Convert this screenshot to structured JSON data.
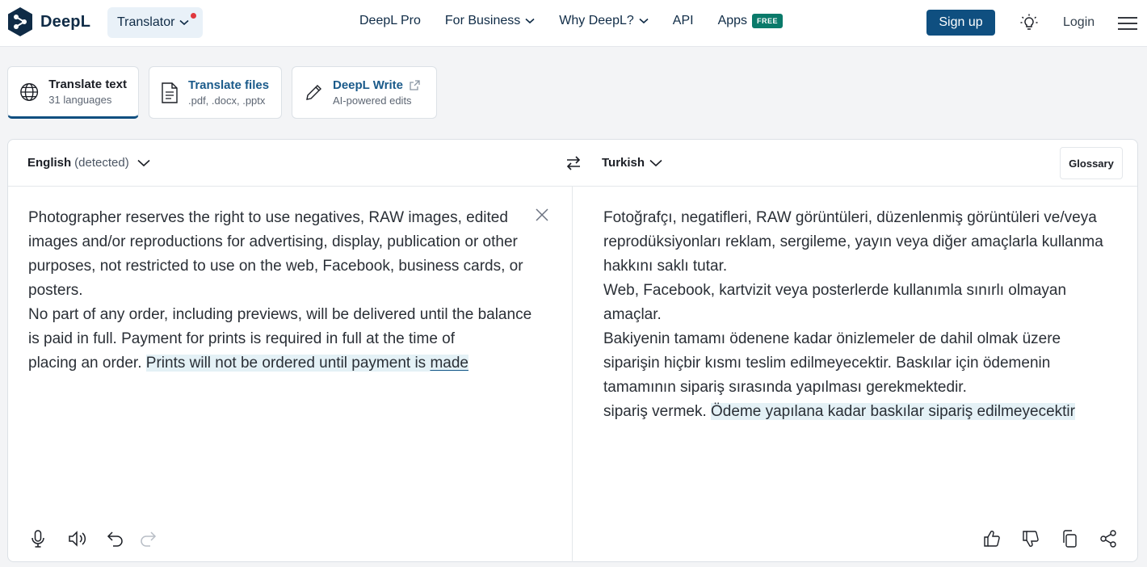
{
  "brand": {
    "name": "DeepL"
  },
  "header": {
    "translator_label": "Translator",
    "nav": [
      {
        "label": "DeepL Pro",
        "dropdown": false
      },
      {
        "label": "For Business",
        "dropdown": true
      },
      {
        "label": "Why DeepL?",
        "dropdown": true
      },
      {
        "label": "API",
        "dropdown": false
      },
      {
        "label": "Apps",
        "dropdown": false,
        "badge": "FREE"
      }
    ],
    "signup_label": "Sign up",
    "login_label": "Login"
  },
  "modes": [
    {
      "title": "Translate text",
      "subtitle": "31 languages",
      "icon": "globe-icon",
      "active": true
    },
    {
      "title": "Translate files",
      "subtitle": ".pdf, .docx, .pptx",
      "icon": "document-icon",
      "active": false
    },
    {
      "title": "DeepL Write",
      "subtitle": "AI-powered edits",
      "icon": "pen-icon",
      "active": false
    }
  ],
  "translator": {
    "source_lang": "English",
    "source_detected": "(detected)",
    "target_lang": "Turkish",
    "glossary_label": "Glossary",
    "source_lines": [
      "Photographer reserves the right to use negatives, RAW images, edited images and/or reproductions for advertising, display, publication or other",
      "purposes, not restricted to use on the web, Facebook, business cards, or posters.",
      "No part of any order, including previews, will be delivered until the balance is paid in full. Payment for prints is required in full at the time of",
      "placing an order."
    ],
    "source_highlight": "Prints will not be ordered until payment is",
    "source_underlined": "made",
    "target_lines": [
      "Fotoğrafçı, negatifleri, RAW görüntüleri, düzenlenmiş görüntüleri ve/veya reprodüksiyonları reklam, sergileme, yayın veya diğer amaçlarla kullanma hakkını saklı tutar.",
      "Web, Facebook, kartvizit veya posterlerde kullanımla sınırlı olmayan amaçlar.",
      "Bakiyenin tamamı ödenene kadar önizlemeler de dahil olmak üzere siparişin hiçbir kısmı teslim edilmeyecektir. Baskılar için ödemenin tamamının sipariş sırasında yapılması gerekmektedir.",
      "sipariş vermek."
    ],
    "target_highlight": "Ödeme yapılana kadar baskılar sipariş edilmeyecektir"
  },
  "colors": {
    "brand_dark": "#0f2b46",
    "signup_bg": "#0f4f80",
    "free_badge": "#0a7a6a",
    "highlight": "#e4f1f6"
  }
}
